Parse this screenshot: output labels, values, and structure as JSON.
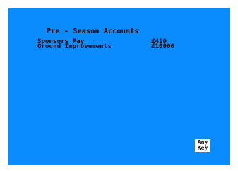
{
  "screen": {
    "title": "Pre - Season Accounts",
    "rows": [
      {
        "label": "Sponsors Pay",
        "value": "£410"
      },
      {
        "label": "Ground Improvements",
        "value": "£10000"
      }
    ],
    "prompt": {
      "line1": "Any",
      "line2": "Key"
    }
  },
  "colors": {
    "background": "#0a8cff",
    "border": "#ffffff",
    "text": "#000000",
    "prompt_bg": "#ffffff"
  }
}
